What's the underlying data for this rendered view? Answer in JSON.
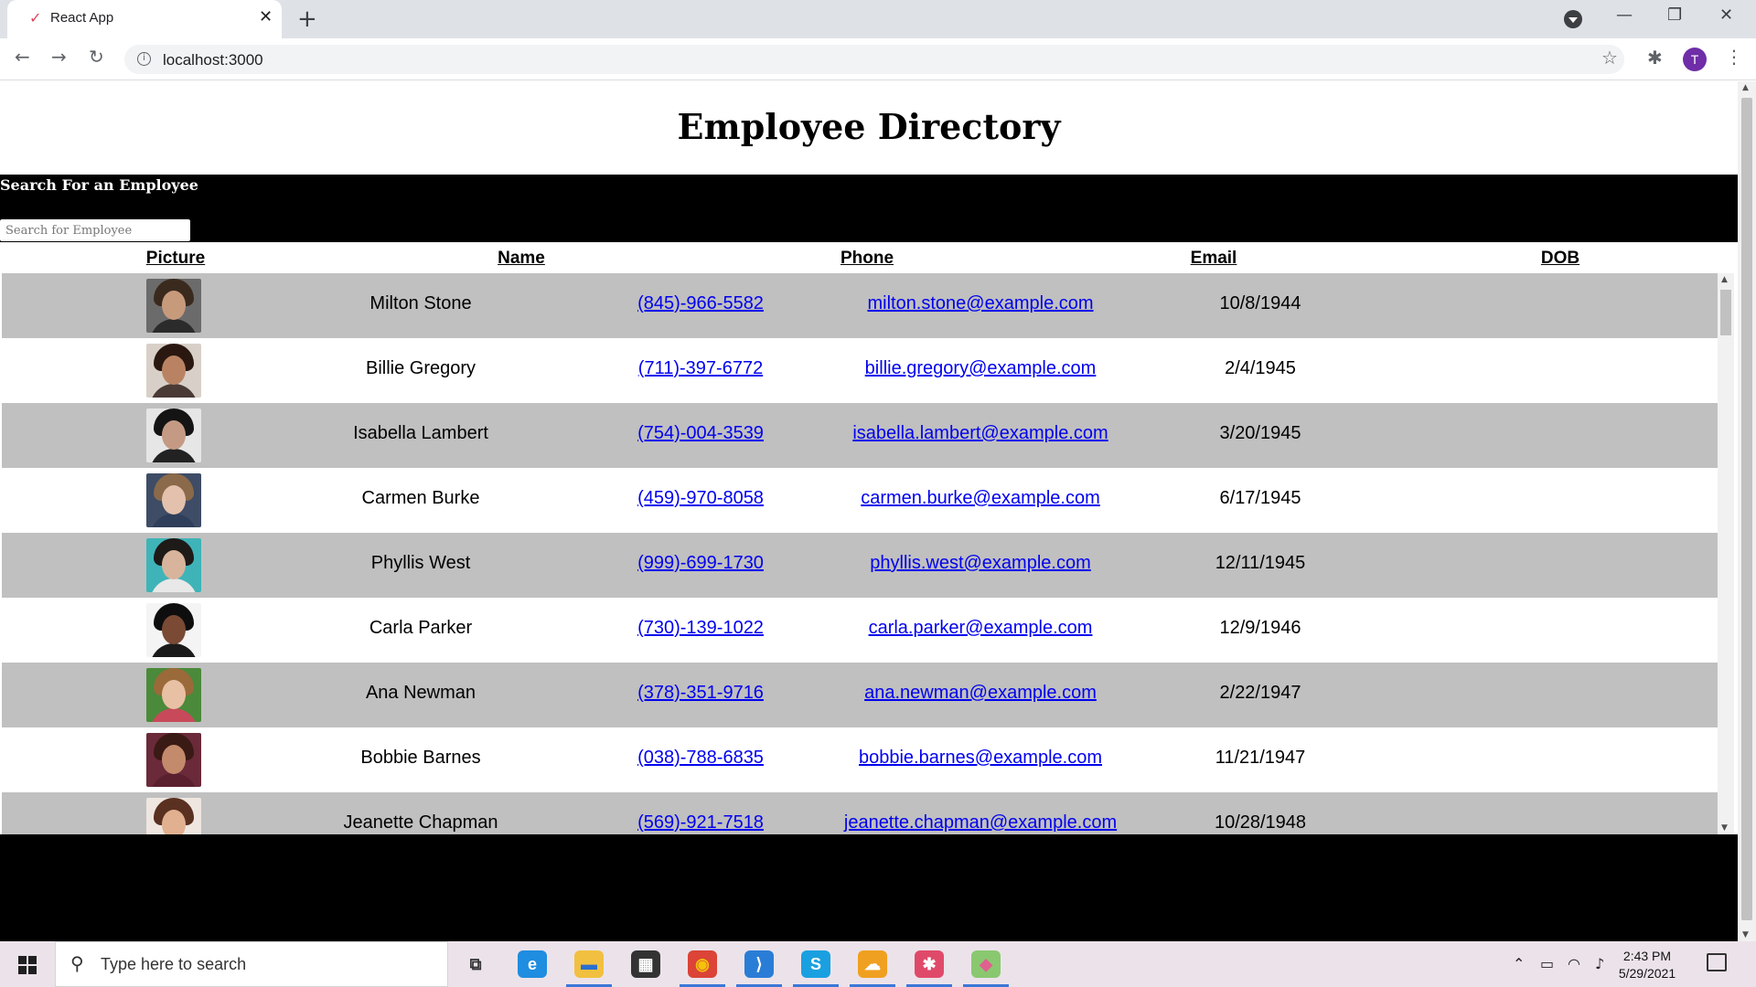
{
  "browser": {
    "tab_title": "React App",
    "favicon_glyph": "✓",
    "close_glyph": "✕",
    "new_tab_glyph": "+",
    "url": "localhost:3000",
    "profile_initial": "T",
    "back_glyph": "←",
    "forward_glyph": "→",
    "reload_glyph": "↻",
    "star_glyph": "☆",
    "extensions_glyph": "✱",
    "menu_glyph": "⋮",
    "minimize_glyph": "—",
    "maximize_glyph": "❐",
    "window_close_glyph": "✕"
  },
  "page": {
    "title": "Employee Directory",
    "search_label": "Search For an Employee",
    "search_placeholder": "Search for Employee",
    "columns": [
      "Picture",
      "Name",
      "Phone",
      "Email",
      "DOB"
    ]
  },
  "employees": [
    {
      "name": "Milton Stone",
      "phone": "(845)-966-5582",
      "email": "milton.stone@example.com",
      "dob": "10/8/1944",
      "hair": "#3a2a1e",
      "skin": "#c89a7c",
      "shirt": "#2b2b2b",
      "bg": "#6b6b6b"
    },
    {
      "name": "Billie Gregory",
      "phone": "(711)-397-6772",
      "email": "billie.gregory@example.com",
      "dob": "2/4/1945",
      "hair": "#2a1810",
      "skin": "#b98363",
      "shirt": "#4a3a36",
      "bg": "#d8d0c8"
    },
    {
      "name": "Isabella Lambert",
      "phone": "(754)-004-3539",
      "email": "isabella.lambert@example.com",
      "dob": "3/20/1945",
      "hair": "#141414",
      "skin": "#c49a84",
      "shirt": "#222222",
      "bg": "#e6e6e6"
    },
    {
      "name": "Carmen Burke",
      "phone": "(459)-970-8058",
      "email": "carmen.burke@example.com",
      "dob": "6/17/1945",
      "hair": "#8a6a4a",
      "skin": "#e3c1ad",
      "shirt": "#2f3e5a",
      "bg": "#3e4c66"
    },
    {
      "name": "Phyllis West",
      "phone": "(999)-699-1730",
      "email": "phyllis.west@example.com",
      "dob": "12/11/1945",
      "hair": "#1e1a18",
      "skin": "#d8b49c",
      "shirt": "#e8e8e8",
      "bg": "#3fb4b8"
    },
    {
      "name": "Carla Parker",
      "phone": "(730)-139-1022",
      "email": "carla.parker@example.com",
      "dob": "12/9/1946",
      "hair": "#0e0e0e",
      "skin": "#7a4a34",
      "shirt": "#1a1a1a",
      "bg": "#f4f4f4"
    },
    {
      "name": "Ana Newman",
      "phone": "(378)-351-9716",
      "email": "ana.newman@example.com",
      "dob": "2/22/1947",
      "hair": "#9a6a3a",
      "skin": "#e8c0a4",
      "shirt": "#c84a5a",
      "bg": "#4a8a3a"
    },
    {
      "name": "Bobbie Barnes",
      "phone": "(038)-788-6835",
      "email": "bobbie.barnes@example.com",
      "dob": "11/21/1947",
      "hair": "#3a1a14",
      "skin": "#c48a6c",
      "shirt": "#5a2030",
      "bg": "#6a2a3a"
    },
    {
      "name": "Jeanette Chapman",
      "phone": "(569)-921-7518",
      "email": "jeanette.chapman@example.com",
      "dob": "10/28/1948",
      "hair": "#5a3020",
      "skin": "#e0b090",
      "shirt": "#c83a3a",
      "bg": "#efe6e0"
    }
  ],
  "taskbar": {
    "search_placeholder": "Type here to search",
    "search_glyph": "⚲",
    "time": "2:43 PM",
    "date": "5/29/2021",
    "apps": [
      {
        "name": "task-view",
        "label": "⧉",
        "color": "#ece3ea",
        "fg": "#333333"
      },
      {
        "name": "edge",
        "label": "e",
        "color": "#1f8de0",
        "fg": "#ffffff"
      },
      {
        "name": "file-explorer",
        "label": "▬",
        "color": "#f2c040",
        "fg": "#2a6fd0"
      },
      {
        "name": "microsoft-store",
        "label": "▦",
        "color": "#333333",
        "fg": "#ffffff"
      },
      {
        "name": "chrome",
        "label": "◉",
        "color": "#db4437",
        "fg": "#f4c20d"
      },
      {
        "name": "vscode",
        "label": "⟩",
        "color": "#2a7dd6",
        "fg": "#ffffff"
      },
      {
        "name": "skype",
        "label": "S",
        "color": "#1aa0e0",
        "fg": "#ffffff"
      },
      {
        "name": "app-cloud",
        "label": "☁",
        "color": "#f0a020",
        "fg": "#ffffff"
      },
      {
        "name": "slack",
        "label": "✱",
        "color": "#e04a6a",
        "fg": "#ffffff"
      },
      {
        "name": "gitkraken",
        "label": "◆",
        "color": "#8ac870",
        "fg": "#e06090"
      }
    ],
    "tray": [
      "⌃",
      "▭",
      "◠",
      "♪"
    ]
  }
}
